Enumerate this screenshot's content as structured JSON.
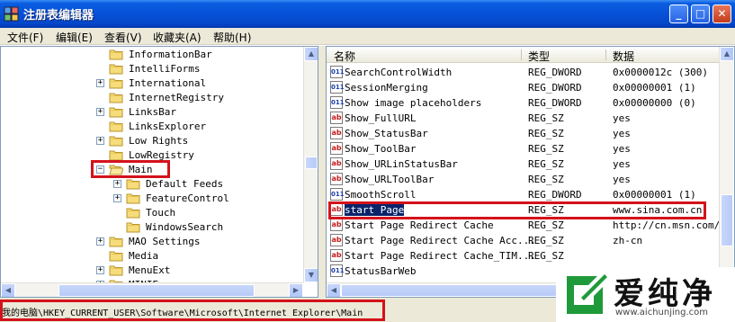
{
  "window": {
    "title": "注册表编辑器"
  },
  "menu": [
    "文件(F)",
    "编辑(E)",
    "查看(V)",
    "收藏夹(A)",
    "帮助(H)"
  ],
  "tree": [
    {
      "label": "InformationBar",
      "level": 1,
      "expander": ""
    },
    {
      "label": "IntelliForms",
      "level": 1,
      "expander": ""
    },
    {
      "label": "International",
      "level": 1,
      "expander": "+"
    },
    {
      "label": "InternetRegistry",
      "level": 1,
      "expander": ""
    },
    {
      "label": "LinksBar",
      "level": 1,
      "expander": "+"
    },
    {
      "label": "LinksExplorer",
      "level": 1,
      "expander": ""
    },
    {
      "label": "Low Rights",
      "level": 1,
      "expander": "+"
    },
    {
      "label": "LowRegistry",
      "level": 1,
      "expander": ""
    },
    {
      "label": "Main",
      "level": 1,
      "expander": "−",
      "open": true
    },
    {
      "label": "Default Feeds",
      "level": 2,
      "expander": "+"
    },
    {
      "label": "FeatureControl",
      "level": 2,
      "expander": "+"
    },
    {
      "label": "Touch",
      "level": 2,
      "expander": ""
    },
    {
      "label": "WindowsSearch",
      "level": 2,
      "expander": ""
    },
    {
      "label": "MAO Settings",
      "level": 1,
      "expander": "+"
    },
    {
      "label": "Media",
      "level": 1,
      "expander": ""
    },
    {
      "label": "MenuExt",
      "level": 1,
      "expander": "+"
    },
    {
      "label": "MINIE",
      "level": 1,
      "expander": "+"
    }
  ],
  "columns": {
    "name": "名称",
    "type": "类型",
    "data": "数据"
  },
  "values": [
    {
      "icon": "dword",
      "name": "SearchControlWidth",
      "type": "REG_DWORD",
      "data": "0x0000012c (300)"
    },
    {
      "icon": "dword",
      "name": "SessionMerging",
      "type": "REG_DWORD",
      "data": "0x00000001 (1)"
    },
    {
      "icon": "dword",
      "name": "Show image placeholders",
      "type": "REG_DWORD",
      "data": "0x00000000 (0)"
    },
    {
      "icon": "sz",
      "name": "Show_FullURL",
      "type": "REG_SZ",
      "data": "yes"
    },
    {
      "icon": "sz",
      "name": "Show_StatusBar",
      "type": "REG_SZ",
      "data": "yes"
    },
    {
      "icon": "sz",
      "name": "Show_ToolBar",
      "type": "REG_SZ",
      "data": "yes"
    },
    {
      "icon": "sz",
      "name": "Show_URLinStatusBar",
      "type": "REG_SZ",
      "data": "yes"
    },
    {
      "icon": "sz",
      "name": "Show_URLToolBar",
      "type": "REG_SZ",
      "data": "yes"
    },
    {
      "icon": "dword",
      "name": "SmoothScroll",
      "type": "REG_DWORD",
      "data": "0x00000001 (1)"
    },
    {
      "icon": "sz",
      "name": "start Page",
      "type": "REG_SZ",
      "data": "www.sina.com.cn",
      "selected": true
    },
    {
      "icon": "sz",
      "name": "Start Page Redirect Cache",
      "type": "REG_SZ",
      "data": "http://cn.msn.com/?"
    },
    {
      "icon": "sz",
      "name": "Start Page Redirect Cache Acc...",
      "type": "REG_SZ",
      "data": "zh-cn"
    },
    {
      "icon": "sz",
      "name": "Start Page Redirect Cache_TIM...",
      "type": "REG_SZ",
      "data": ""
    },
    {
      "icon": "dword",
      "name": "StatusBarWeb",
      "type": "",
      "data": ""
    }
  ],
  "status": {
    "path": "我的电脑\\HKEY_CURRENT_USER\\Software\\Microsoft\\Internet Explorer\\Main"
  },
  "watermark": {
    "brand": "爱纯净",
    "url": "www.aichunjing.com"
  },
  "colors": {
    "titlebar": "#0651d7",
    "selection": "#0a246a",
    "highlight_box": "#d4121b",
    "watermark_green": "#1f9a3a"
  }
}
